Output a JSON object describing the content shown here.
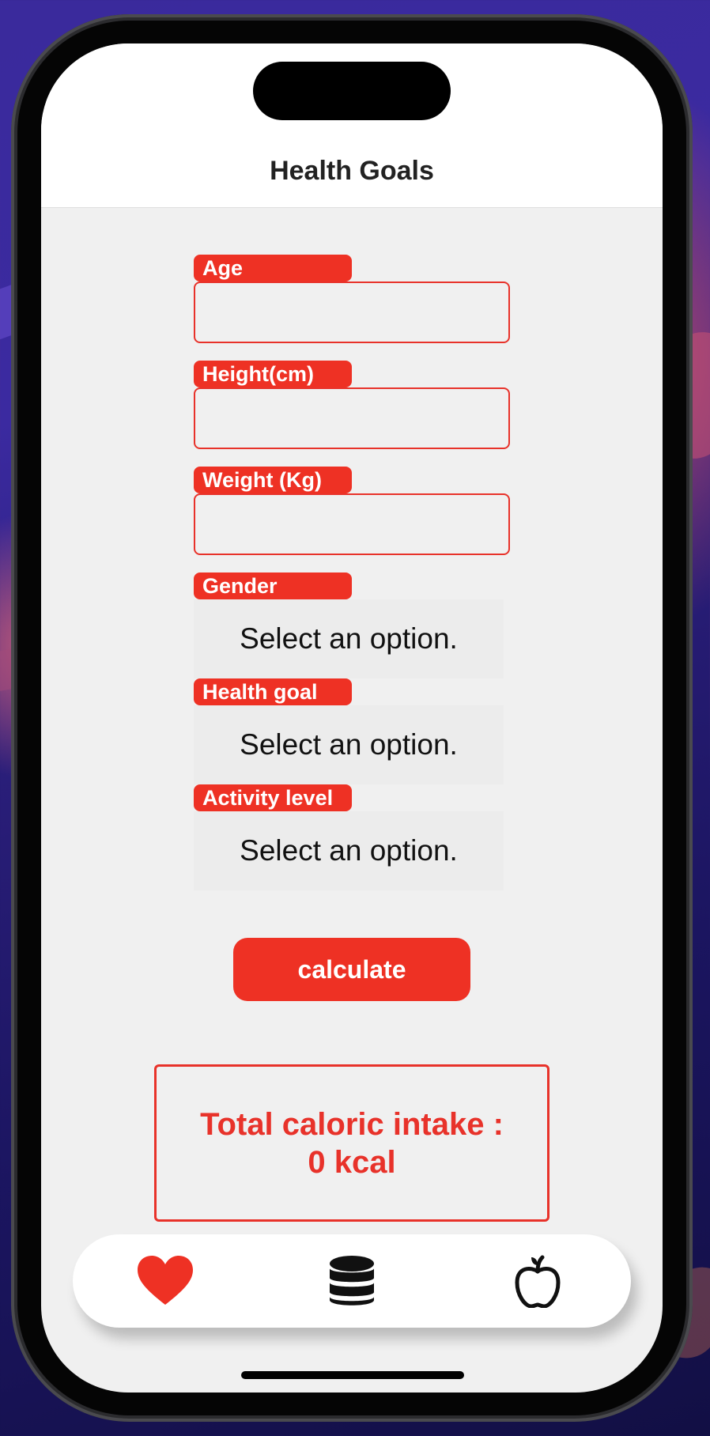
{
  "header": {
    "title": "Health Goals"
  },
  "form": {
    "age_label": "Age",
    "height_label": "Height(cm)",
    "weight_label": "Weight (Kg)",
    "gender_label": "Gender",
    "gender_value": "Select an option.",
    "health_goal_label": "Health goal",
    "health_goal_value": "Select an option.",
    "activity_label": "Activity level",
    "activity_value": "Select an option."
  },
  "calculate_label": "calculate",
  "result": {
    "line1": "Total caloric intake :",
    "line2": "0 kcal"
  },
  "tabbar": {
    "items": [
      {
        "icon": "heart-icon",
        "active": true
      },
      {
        "icon": "database-icon",
        "active": false
      },
      {
        "icon": "apple-icon",
        "active": false
      }
    ]
  },
  "colors": {
    "accent": "#ee3124",
    "background": "#f0f0f0",
    "select_background": "#ececec",
    "tab_active": "#ee3124",
    "tab_inactive": "#111111"
  }
}
